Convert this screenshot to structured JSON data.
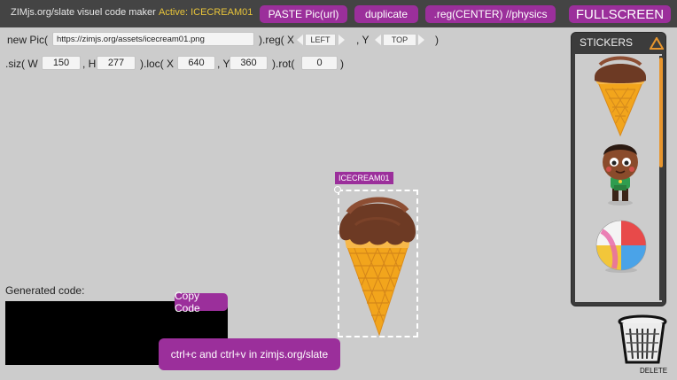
{
  "topbar": {
    "app_title": "ZIMjs.org/slate visuel code maker",
    "active_label": "Active: ICECREAM01",
    "paste_label": "PASTE Pic(url)",
    "duplicate_label": "duplicate",
    "reg_label": ".reg(CENTER) //physics",
    "fullscreen_label": "FULLSCREEN"
  },
  "row1": {
    "new_pic_label": "new Pic(",
    "url_value": "https://zimjs.org/assets/icecream01.png",
    "reg_open_label": ").reg( X",
    "reg_x_value": "LEFT",
    "reg_y_label": ", Y",
    "reg_y_value": "TOP",
    "close_paren": ")"
  },
  "row2": {
    "siz_label": ".siz( W",
    "w_value": "150",
    "h_label": ", H",
    "h_value": "277",
    "loc_label": ").loc( X",
    "x_value": "640",
    "y_label": ", Y",
    "y_value": "360",
    "rot_label": ").rot(",
    "rot_value": "0",
    "close_paren": ")"
  },
  "stickers": {
    "title": "STICKERS",
    "icon": "triangle-icon",
    "items": [
      "icecream-sticker",
      "character-sticker",
      "beachball-sticker"
    ]
  },
  "canvas": {
    "object_tag": "ICECREAM01"
  },
  "code": {
    "label": "Generated code:",
    "copy_label": "Copy Code",
    "tip": "ctrl+c and ctrl+v in zimjs.org/slate"
  },
  "trash": {
    "label": "DELETE"
  },
  "colors": {
    "accent": "#9b2f9b",
    "topbar": "#444444",
    "background": "#cccccc",
    "active_text": "#e8c43a",
    "scroll_thumb": "#e8962e"
  }
}
